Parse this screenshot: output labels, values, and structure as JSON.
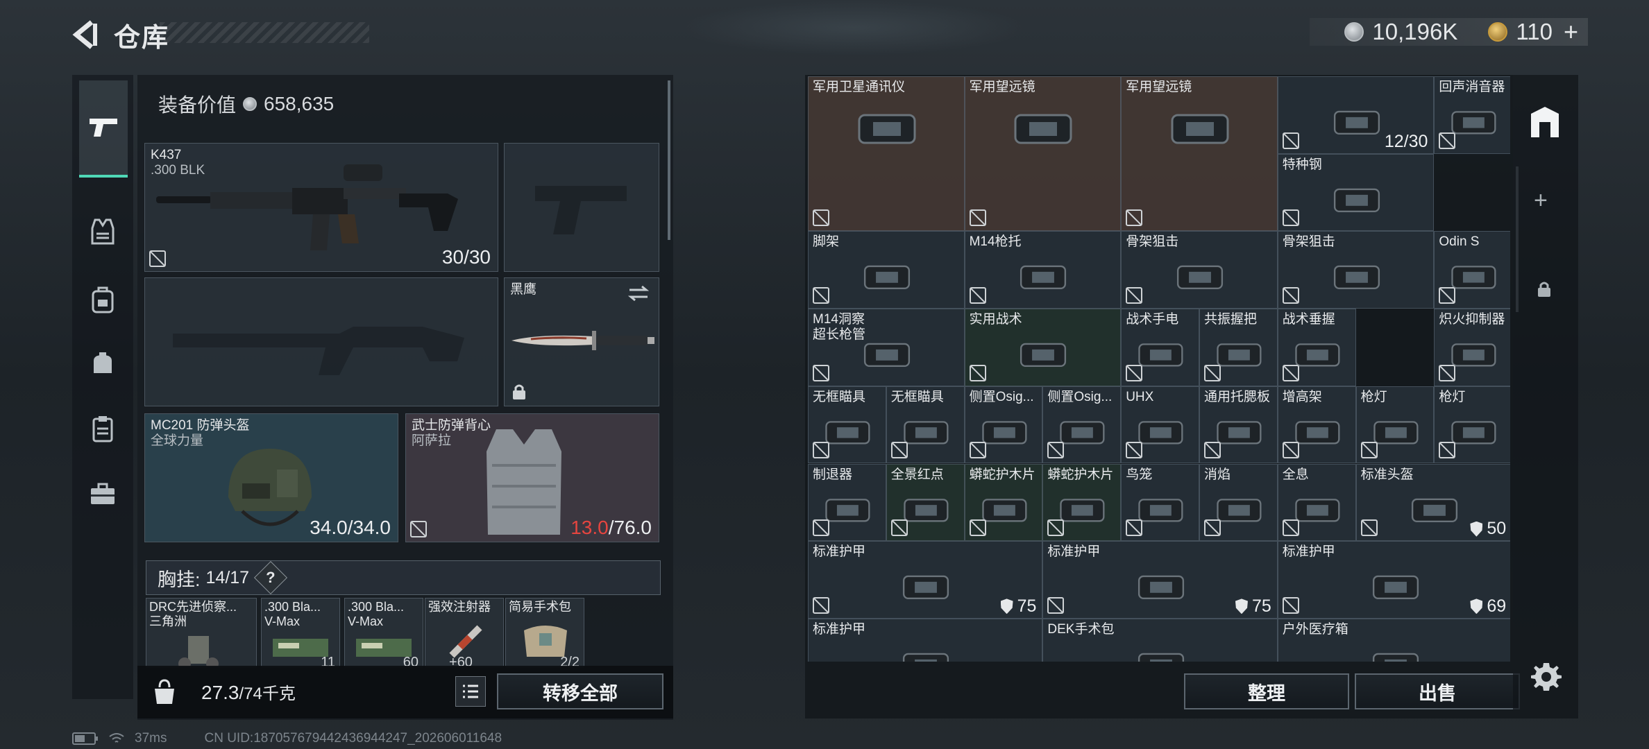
{
  "header": {
    "title": "仓库",
    "currency1": "10,196K",
    "currency2": "110"
  },
  "equip_value_label": "装备价值",
  "equip_value": "658,635",
  "slots": {
    "primary": {
      "name": "K437",
      "ammo": ".300 BLK",
      "count": "30/30"
    },
    "knife": {
      "name": "黑鹰"
    },
    "helmet": {
      "name": "MC201 防弹头盔",
      "sub": "全球力量",
      "count": "34.0/34.0"
    },
    "armor": {
      "name": "武士防弹背心",
      "sub": "阿萨拉",
      "count_cur": "13.0",
      "count_max": "/76.0"
    }
  },
  "chest": {
    "label": "胸挂:",
    "count": "14/17",
    "help": "?"
  },
  "chest_items": [
    {
      "name": "DRC先进侦察...",
      "sub": "三角洲",
      "qty": ""
    },
    {
      "name": ".300 Bla...",
      "sub": "V-Max",
      "qty": "11"
    },
    {
      "name": ".300 Bla...",
      "sub": "V-Max",
      "qty": "60"
    },
    {
      "name": "强效注射器",
      "sub": "",
      "qty": "60"
    },
    {
      "name": "简易手术包",
      "sub": "",
      "qty": "2/2"
    }
  ],
  "weight": {
    "value": "27.3",
    "max": "/74千克"
  },
  "buttons": {
    "transfer_all": "转移全部",
    "sort": "整理",
    "sell": "出售"
  },
  "status": {
    "ping": "37ms",
    "uid": "CN UID:1870576794424369442​47_202606011648"
  },
  "storage": [
    {
      "name": "军用卫星通讯仪",
      "count": "",
      "armor": false
    },
    {
      "name": "军用望远镜",
      "count": "",
      "armor": false
    },
    {
      "name": "军用望远镜",
      "count": "",
      "armor": false
    },
    {
      "name": "",
      "count": "12/30",
      "armor": false
    },
    {
      "name": "回声消音器",
      "count": "",
      "armor": false
    },
    {
      "name": "特种钢",
      "count": "",
      "armor": false
    },
    {
      "name": "脚架",
      "count": "",
      "armor": false
    },
    {
      "name": "M14枪托",
      "count": "",
      "armor": false
    },
    {
      "name": "骨架狙击",
      "count": "",
      "armor": false
    },
    {
      "name": "骨架狙击",
      "count": "",
      "armor": false
    },
    {
      "name": "Odin S",
      "count": "",
      "armor": false
    },
    {
      "name": "M14洞察\n超长枪管",
      "count": "",
      "armor": false
    },
    {
      "name": "实用战术",
      "count": "",
      "armor": false
    },
    {
      "name": "战术手电",
      "count": "",
      "armor": false
    },
    {
      "name": "共振握把",
      "count": "",
      "armor": false
    },
    {
      "name": "战术垂握",
      "count": "",
      "armor": false
    },
    {
      "name": "炽火抑制器",
      "count": "",
      "armor": false
    },
    {
      "name": "无框瞄具",
      "count": "",
      "armor": false
    },
    {
      "name": "无框瞄具",
      "count": "",
      "armor": false
    },
    {
      "name": "侧置Osig...",
      "count": "",
      "armor": false
    },
    {
      "name": "侧置Osig...",
      "count": "",
      "armor": false
    },
    {
      "name": "UHX",
      "count": "",
      "armor": false
    },
    {
      "name": "通用托腮板",
      "count": "",
      "armor": false
    },
    {
      "name": "增高架",
      "count": "",
      "armor": false
    },
    {
      "name": "枪灯",
      "count": "",
      "armor": false
    },
    {
      "name": "枪灯",
      "count": "",
      "armor": false
    },
    {
      "name": "制退器",
      "count": "",
      "armor": false
    },
    {
      "name": "全景红点",
      "count": "",
      "armor": false
    },
    {
      "name": "蟒蛇护木片",
      "count": "",
      "armor": false
    },
    {
      "name": "蟒蛇护木片",
      "count": "",
      "armor": false
    },
    {
      "name": "鸟笼",
      "count": "",
      "armor": false
    },
    {
      "name": "消焰",
      "count": "",
      "armor": false
    },
    {
      "name": "全息",
      "count": "",
      "armor": false
    },
    {
      "name": "标准头盔",
      "count": "50",
      "armor": true
    },
    {
      "name": "标准护甲",
      "count": "75",
      "armor": true
    },
    {
      "name": "标准护甲",
      "count": "75",
      "armor": true
    },
    {
      "name": "标准护甲",
      "count": "69",
      "armor": true
    },
    {
      "name": "标准护甲",
      "count": "",
      "armor": false
    },
    {
      "name": "DEK手术包",
      "count": "",
      "armor": false
    },
    {
      "name": "户外医疗箱",
      "count": "",
      "armor": false
    }
  ]
}
